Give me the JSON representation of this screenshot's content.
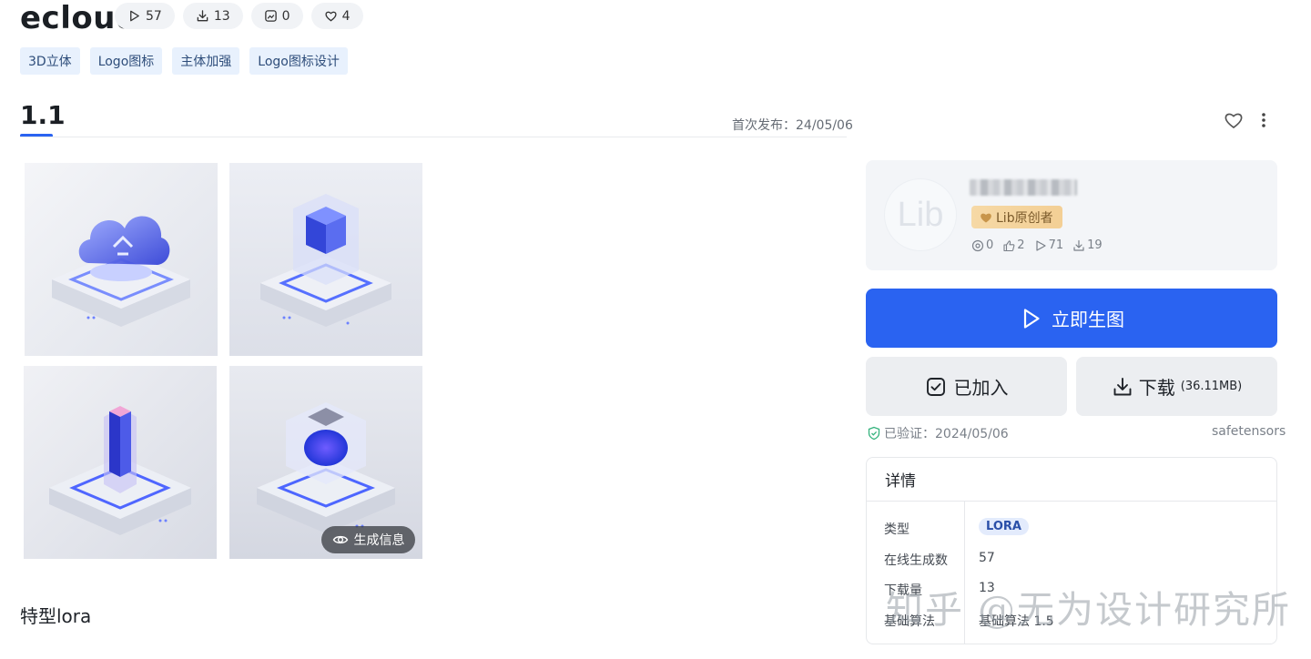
{
  "header": {
    "title": "ecloud",
    "stats": [
      {
        "icon": "play-icon",
        "value": "57"
      },
      {
        "icon": "download-icon",
        "value": "13"
      },
      {
        "icon": "image-comment-icon",
        "value": "0"
      },
      {
        "icon": "heart-icon",
        "value": "4"
      }
    ],
    "tags": [
      "3D立体",
      "Logo图标",
      "主体加强",
      "Logo图标设计"
    ]
  },
  "version": {
    "label": "1.1",
    "published": "首次发布：24/05/06"
  },
  "gallery": {
    "gen_info_label": "生成信息",
    "images": [
      "cloud-icon-3d",
      "cube-icon-3d",
      "pillar-icon-3d",
      "crystal-cube-icon-3d"
    ]
  },
  "description": "特型lora",
  "author": {
    "avatar_text": "Lib",
    "badge": "Lib原创者",
    "stats": [
      {
        "icon": "at-icon",
        "value": "0"
      },
      {
        "icon": "like-icon",
        "value": "2"
      },
      {
        "icon": "play-icon",
        "value": "71"
      },
      {
        "icon": "download-icon",
        "value": "19"
      }
    ]
  },
  "actions": {
    "generate": "立即生图",
    "added": "已加入",
    "download": "下载",
    "download_size": "(36.11MB)"
  },
  "verification": {
    "text": "已验证：2024/05/06",
    "format": "safetensors"
  },
  "details": {
    "title": "详情",
    "rows": [
      {
        "label": "类型",
        "value": "LORA"
      },
      {
        "label": "在线生成数",
        "value": "57"
      },
      {
        "label": "下载量",
        "value": "13"
      },
      {
        "label": "基础算法",
        "value": "基础算法 1.5"
      }
    ]
  },
  "watermark": "知乎 @无为设计研究所",
  "colors": {
    "accent": "#2a63f1",
    "tag_bg": "#e8f1fd",
    "badge_gold": "#f3cf95"
  }
}
